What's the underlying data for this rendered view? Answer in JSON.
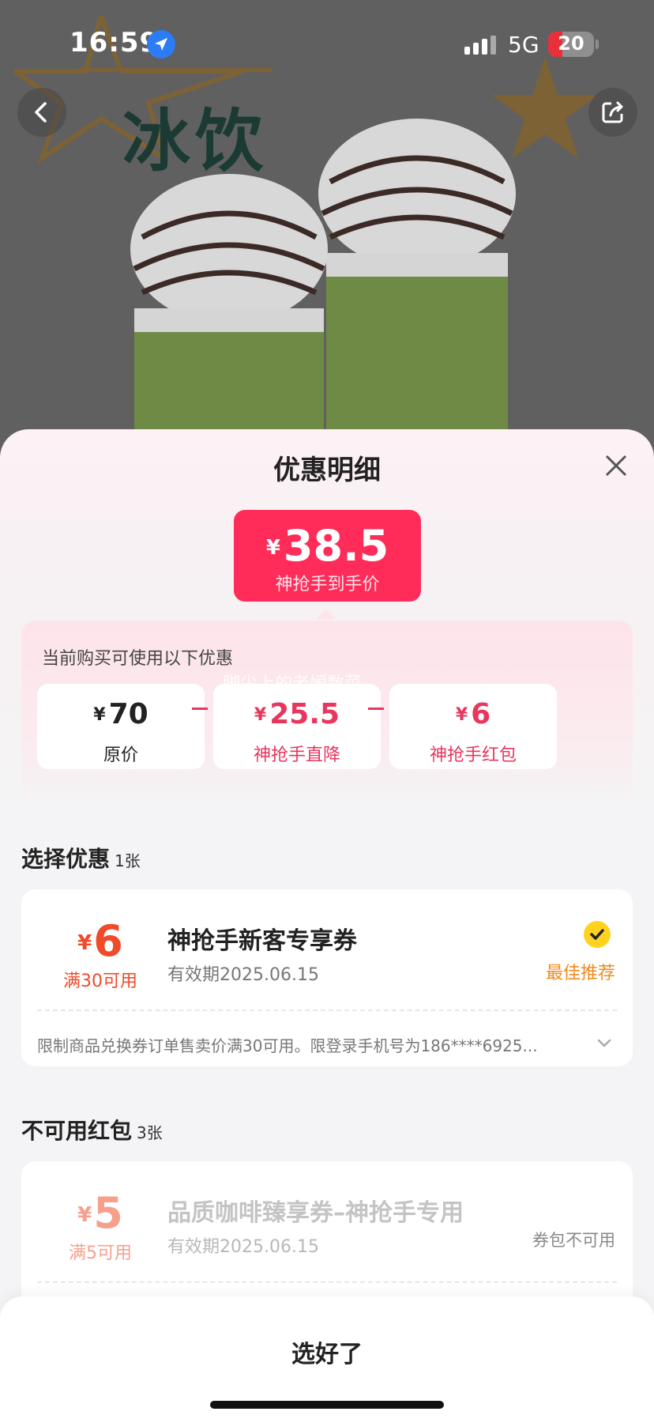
{
  "statusbar": {
    "time": "16:59",
    "network": "5G",
    "battery": "20",
    "battery_level": 0.2,
    "battery_color": "#e8303a"
  },
  "hero": {
    "title": "冰饮",
    "back_icon": "chevron-left-icon",
    "share_icon": "share-icon"
  },
  "sheet": {
    "title": "优惠明细",
    "close_icon": "close-icon",
    "final_price": {
      "symbol": "¥",
      "value": "38.5",
      "label": "神抢手到手价",
      "color": "#ff2c5a"
    },
    "discounts": {
      "caption": "当前购买可使用以下优惠",
      "watermark": "脚尖上的老嫒数菜",
      "items": [
        {
          "symbol": "¥",
          "value": "70",
          "label": "原价",
          "color": "#222222"
        },
        {
          "symbol": "¥",
          "value": "25.5",
          "label": "神抢手直降",
          "color": "#e8365d"
        },
        {
          "symbol": "¥",
          "value": "6",
          "label": "神抢手红包",
          "color": "#e8365d"
        }
      ],
      "operator": "-"
    }
  },
  "select_section": {
    "title": "选择优惠",
    "count": "1张",
    "coupons": [
      {
        "symbol": "¥",
        "amount": "6",
        "condition": "满30可用",
        "name": "神抢手新客专享券",
        "validity": "有效期2025.06.15",
        "status": "最佳推荐",
        "selected": true,
        "rule": "限制商品兑换券订单售卖价满30可用。限登录手机号为186****6925...",
        "color": "#f04a2a"
      }
    ]
  },
  "unavailable_section": {
    "title": "不可用红包",
    "count": "3张",
    "coupons": [
      {
        "symbol": "¥",
        "amount": "5",
        "condition": "满5可用",
        "name": "品质咖啡臻享券–神抢手专用",
        "validity": "有效期2025.06.15",
        "status": "券包不可用",
        "color": "#f6a08c"
      }
    ]
  },
  "footer": {
    "done_label": "选好了"
  }
}
